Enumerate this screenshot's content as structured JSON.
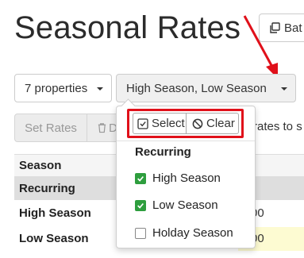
{
  "page_title": "Seasonal Rates",
  "batch_button_label": "Bat",
  "properties_dropdown": {
    "label": "7 properties"
  },
  "seasons_dropdown": {
    "label": "High Season, Low Season"
  },
  "toolbar": {
    "set_rates_label": "Set Rates",
    "delete_label": "D",
    "trailing_text": "rates to s"
  },
  "table": {
    "header": "Season",
    "group": "Recurring",
    "rows": [
      {
        "label": "High Season",
        "value_fragment": "00"
      },
      {
        "label": "Low Season",
        "value_fragment": "00"
      }
    ]
  },
  "season_menu": {
    "select_label": "Select",
    "clear_label": "Clear",
    "group_label": "Recurring",
    "options": [
      {
        "label": "High Season",
        "checked": true
      },
      {
        "label": "Low Season",
        "checked": true
      },
      {
        "label": "Holday Season",
        "checked": false
      }
    ]
  },
  "colors": {
    "annotation": "#e0101a",
    "checkbox_checked": "#2e9e3e",
    "highlight_cell": "#fdfbd2"
  }
}
